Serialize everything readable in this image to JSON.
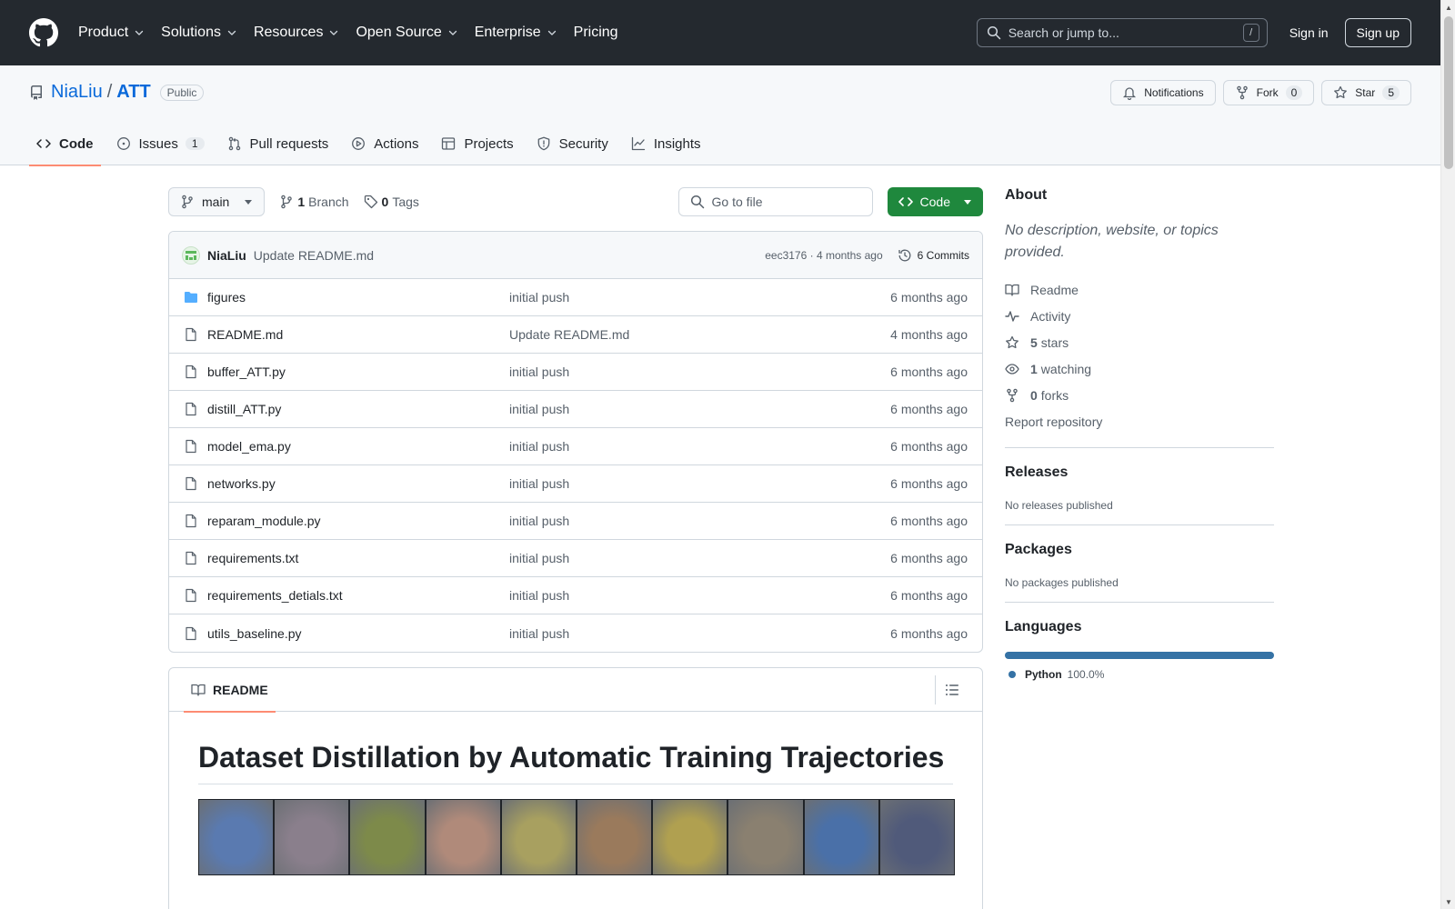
{
  "header": {
    "nav": [
      {
        "label": "Product",
        "dropdown": true
      },
      {
        "label": "Solutions",
        "dropdown": true
      },
      {
        "label": "Resources",
        "dropdown": true
      },
      {
        "label": "Open Source",
        "dropdown": true
      },
      {
        "label": "Enterprise",
        "dropdown": true
      },
      {
        "label": "Pricing",
        "dropdown": false
      }
    ],
    "search_placeholder": "Search or jump to...",
    "search_shortcut": "/",
    "sign_in": "Sign in",
    "sign_up": "Sign up"
  },
  "repo": {
    "owner": "NiaLiu",
    "separator": "/",
    "name": "ATT",
    "visibility": "Public",
    "notifications_label": "Notifications",
    "fork_label": "Fork",
    "fork_count": "0",
    "star_label": "Star",
    "star_count": "5"
  },
  "tabs": [
    {
      "label": "Code",
      "icon": "code-icon",
      "count": ""
    },
    {
      "label": "Issues",
      "icon": "issue-icon",
      "count": "1"
    },
    {
      "label": "Pull requests",
      "icon": "pull-request-icon",
      "count": ""
    },
    {
      "label": "Actions",
      "icon": "play-icon",
      "count": ""
    },
    {
      "label": "Projects",
      "icon": "table-icon",
      "count": ""
    },
    {
      "label": "Security",
      "icon": "shield-icon",
      "count": ""
    },
    {
      "label": "Insights",
      "icon": "graph-icon",
      "count": ""
    }
  ],
  "toolbar": {
    "branch": "main",
    "branch_count": "1",
    "branch_label": "Branch",
    "tag_count": "0",
    "tag_label": "Tags",
    "goto_placeholder": "Go to file",
    "code_label": "Code"
  },
  "commit": {
    "author": "NiaLiu",
    "message": "Update README.md",
    "meta": "eec3176 · 4 months ago",
    "commits_label": "6 Commits"
  },
  "files": [
    {
      "name": "figures",
      "type": "folder",
      "commit": "initial push",
      "age": "6 months ago"
    },
    {
      "name": "README.md",
      "type": "file",
      "commit": "Update README.md",
      "age": "4 months ago"
    },
    {
      "name": "buffer_ATT.py",
      "type": "file",
      "commit": "initial push",
      "age": "6 months ago"
    },
    {
      "name": "distill_ATT.py",
      "type": "file",
      "commit": "initial push",
      "age": "6 months ago"
    },
    {
      "name": "model_ema.py",
      "type": "file",
      "commit": "initial push",
      "age": "6 months ago"
    },
    {
      "name": "networks.py",
      "type": "file",
      "commit": "initial push",
      "age": "6 months ago"
    },
    {
      "name": "reparam_module.py",
      "type": "file",
      "commit": "initial push",
      "age": "6 months ago"
    },
    {
      "name": "requirements.txt",
      "type": "file",
      "commit": "initial push",
      "age": "6 months ago"
    },
    {
      "name": "requirements_detials.txt",
      "type": "file",
      "commit": "initial push",
      "age": "6 months ago"
    },
    {
      "name": "utils_baseline.py",
      "type": "file",
      "commit": "initial push",
      "age": "6 months ago"
    }
  ],
  "readme": {
    "tab_label": "README",
    "title": "Dataset Distillation by Automatic Training Trajectories",
    "thumbnails": [
      "#5a7ab0",
      "#8a7f8c",
      "#7d8a4a",
      "#b08a7a",
      "#a8a060",
      "#9a7a5c",
      "#b0a050",
      "#8a8070",
      "#4a70a8",
      "#505a7a"
    ]
  },
  "about": {
    "title": "About",
    "description": "No description, website, or topics provided.",
    "readme_label": "Readme",
    "activity_label": "Activity",
    "stars_count": "5",
    "stars_label": "stars",
    "watching_count": "1",
    "watching_label": "watching",
    "forks_count": "0",
    "forks_label": "forks",
    "report_label": "Report repository"
  },
  "releases": {
    "title": "Releases",
    "empty": "No releases published"
  },
  "packages": {
    "title": "Packages",
    "empty": "No packages published"
  },
  "languages": {
    "title": "Languages",
    "items": [
      {
        "name": "Python",
        "percent": "100.0%",
        "color": "#3572A5"
      }
    ]
  },
  "colors": {
    "header_bg": "#24292f",
    "link": "#0969da",
    "primary_button": "#1f883d",
    "tab_underline": "#fd8c73"
  }
}
